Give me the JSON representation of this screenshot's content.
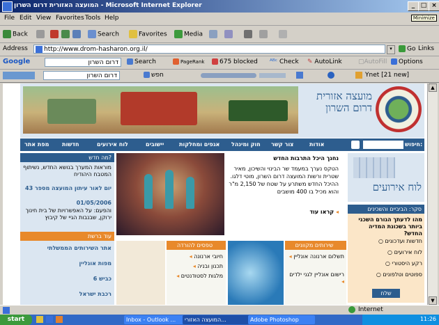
{
  "window": {
    "title": "המועצה האזורית דרום השרון - Microsoft Internet Explorer",
    "controls": {
      "minimize": "_",
      "maximize": "□",
      "close": "×"
    },
    "minimize_tooltip": "Minimize"
  },
  "menu": [
    "File",
    "Edit",
    "View",
    "Favorites",
    "Tools",
    "Help"
  ],
  "toolbar": {
    "back": "Back",
    "search": "Search",
    "favorites": "Favorites",
    "media": "Media"
  },
  "address": {
    "label": "Address",
    "url": "http://www.drom-hasharon.org.il/",
    "go": "Go",
    "links": "Links"
  },
  "googlebar": {
    "brand": "Google",
    "query": "דרום השרון",
    "search": "Search",
    "pagerank": "PageRank",
    "blocked": "675 blocked",
    "check": "Check",
    "autolink": "AutoLink",
    "autofill": "AutoFill",
    "options": "Options"
  },
  "toolbar2": {
    "query": "דרום השרון",
    "search_label": "חפש",
    "ynet": "Ynet [21 new]"
  },
  "site": {
    "logo_title_line1": "מועצה אזורית",
    "logo_title_line2": "דרום השרון",
    "nav": [
      "אודות",
      "צור קשר",
      "חוק ומינהל",
      "אגפים ומחלקות",
      "יישובים",
      "לוח אירועים",
      "חדשות",
      "מפת אתר"
    ],
    "search_label": "חיפוש:",
    "whats_new_header": "מה חדש?",
    "whats_new_text": "מוראות המערך בנושא החדש, נשיתוף המטבח היהודיח",
    "yom_title": "יום לאור עיתון המועצה מספר 43",
    "yom_date": "01/05/2006",
    "yom_body": "והפעם: על האפשרויות של בית חינוך ירוקן, שבנבות הגיי של קיבוץ",
    "former_issues": "עוד גיליונות",
    "news_title": "נחנך היכל התרבות החדש",
    "news_body": "הטקס נערך במעמד שר הבינוי והשיכון, מאיר שטרית ורשות המועצה דרום השרון, מוטי דלגו. ההיכל החדש משתרע על שטח של 2,150 מ\"ר והוא מכיל בו 400 מושבים",
    "read_more": "קראו עוד",
    "events_label": "לוח אירועים",
    "poll_header": "סקר: הביביים והשכינים",
    "poll_question": "מהו לדעתך הגורם השכני ביותר בשכונת המדיה החדש?",
    "poll_options": [
      "חדשות ועדכונים",
      "לוח אירועים",
      "רקע היסטורי",
      "ספוטים וטלפונים"
    ],
    "poll_submit": "שלח",
    "sidebar_links": [
      "אתר השירותים הממשלתי",
      "מפות אונליין",
      "כביש 6",
      "רכבת ישראל"
    ],
    "sidebar_header": "עוד ברשת",
    "forms_header": "טפסים להורדה",
    "forms_items": [
      "חיובי ארנונה",
      "תכנון ובניה",
      "מלגות לסטודנטים"
    ],
    "services_header": "שירותים מקוונים",
    "services_items": [
      "תשלום ארנונה אונליין",
      "רישום אונליין לגני ילדים"
    ]
  },
  "status": {
    "zone": "Internet"
  },
  "taskbar": {
    "start": "start",
    "tasks": [
      "Inbox - Outlook ...",
      "המועצה האזורי...",
      "Adobe Photoshop"
    ],
    "clock": "11:26"
  },
  "colors": {
    "nav_blue": "#2d5d8e",
    "orange": "#e8892b",
    "light_blue": "#dbe6f1"
  }
}
